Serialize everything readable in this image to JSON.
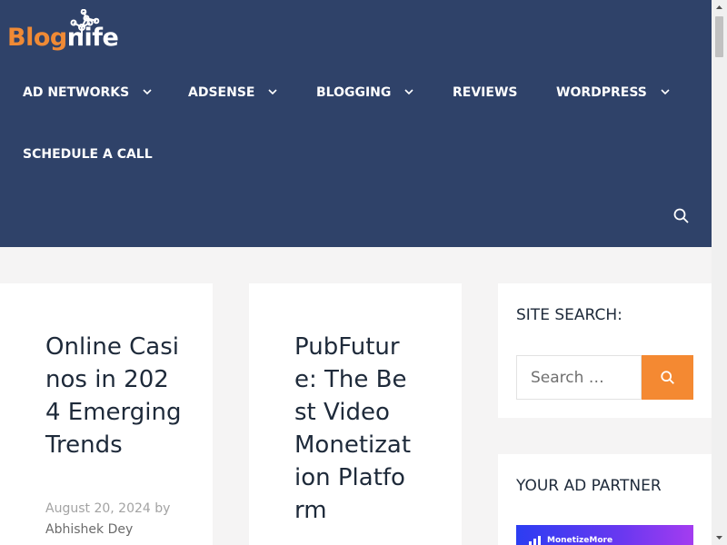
{
  "site": {
    "logo_part1": "Blog",
    "logo_part2": "nife",
    "brand_color": "#f08a35",
    "header_bg": "#2f4269"
  },
  "nav": {
    "items": [
      {
        "label": "AD NETWORKS",
        "has_dropdown": true
      },
      {
        "label": "ADSENSE",
        "has_dropdown": true
      },
      {
        "label": "BLOGGING",
        "has_dropdown": true
      },
      {
        "label": "REVIEWS",
        "has_dropdown": false
      },
      {
        "label": "WORDPRESS",
        "has_dropdown": true
      },
      {
        "label": "SCHEDULE A CALL",
        "has_dropdown": false
      }
    ],
    "search_icon": "search-icon"
  },
  "posts": [
    {
      "title": "Online Casinos in 2024 Emerging Trends",
      "date": "August 20, 2024",
      "by": "by",
      "author": "Abhishek Dey"
    },
    {
      "title": "PubFuture: The Best Video Monetization Platform"
    }
  ],
  "sidebar": {
    "search_title": "SITE SEARCH:",
    "search_placeholder": "Search …",
    "search_button_color": "#f48932",
    "ad_title": "YOUR AD PARTNER",
    "ad_banner_text": "MonetizeMore"
  }
}
